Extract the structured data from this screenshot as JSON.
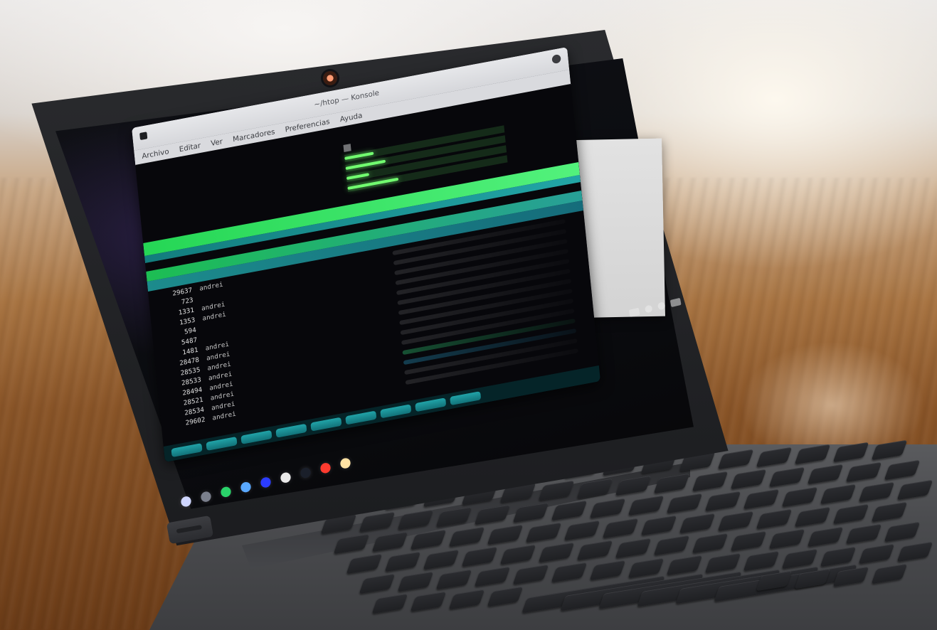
{
  "scene": {
    "colors": {
      "accent_green": "#53f27c",
      "accent_teal": "#25b7b7",
      "terminal_bg": "#07070b"
    }
  },
  "terminal": {
    "window_title": "~/htop — Konsole",
    "menu": [
      "Archivo",
      "Editar",
      "Ver",
      "Marcadores",
      "Preferencias",
      "Ayuda"
    ],
    "processes": [
      {
        "pid": "29637",
        "user": "andrei"
      },
      {
        "pid": "723",
        "user": ""
      },
      {
        "pid": "1331",
        "user": "andrei"
      },
      {
        "pid": "1353",
        "user": "andrei"
      },
      {
        "pid": "594",
        "user": ""
      },
      {
        "pid": "5487",
        "user": ""
      },
      {
        "pid": "1481",
        "user": "andrei"
      },
      {
        "pid": "28478",
        "user": "andrei"
      },
      {
        "pid": "28535",
        "user": "andrei"
      },
      {
        "pid": "28533",
        "user": "andrei"
      },
      {
        "pid": "28494",
        "user": "andrei"
      },
      {
        "pid": "28521",
        "user": "andrei"
      },
      {
        "pid": "28534",
        "user": "andrei"
      },
      {
        "pid": "29602",
        "user": "andrei"
      }
    ]
  }
}
